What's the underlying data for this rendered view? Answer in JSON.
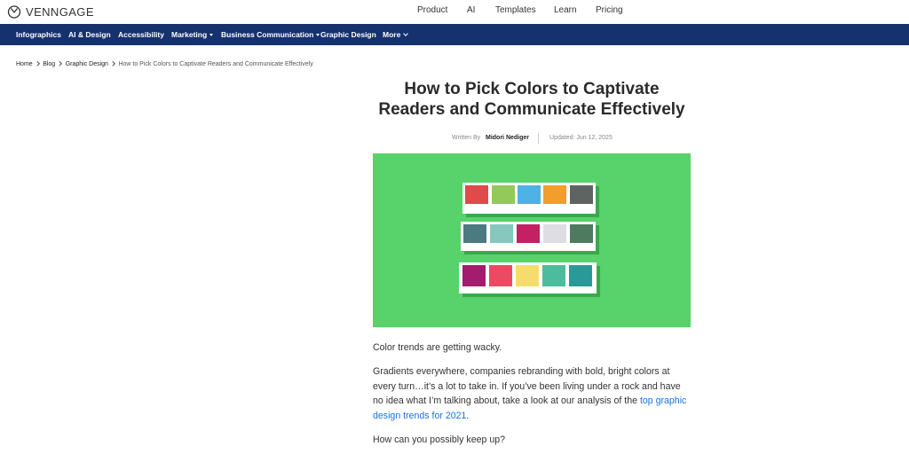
{
  "brand": {
    "name": "VENNGAGE",
    "logo_icon": "venngage-logo-icon"
  },
  "top_nav": {
    "items": [
      "Product",
      "AI",
      "Templates",
      "Learn",
      "Pricing"
    ]
  },
  "sub_nav": {
    "items": [
      {
        "label": "Infographics",
        "dropdown": false
      },
      {
        "label": "AI & Design",
        "dropdown": false
      },
      {
        "label": "Accessibility",
        "dropdown": false
      },
      {
        "label": "Marketing",
        "dropdown": true
      },
      {
        "label": "Business Communication",
        "dropdown": true
      },
      {
        "label": "Graphic Design",
        "dropdown": false
      },
      {
        "label": "More",
        "dropdown": true
      }
    ],
    "background": "#15316e"
  },
  "breadcrumb": [
    "Home",
    "Blog",
    "Graphic Design",
    "How to Pick Colors to Captivate Readers and Communicate Effectively"
  ],
  "article": {
    "title_line1": "How to Pick Colors to Captivate",
    "title_line2": "Readers and Communicate Effectively",
    "written_by_label": "Written By",
    "author": "Midori Nediger",
    "updated": "Updated: Jun 12, 2025",
    "hero": {
      "background": "#58d26a",
      "palettes": [
        [
          "#e14a4a",
          "#93c95a",
          "#4fb2e6",
          "#f39d2a",
          "#5f6462"
        ],
        [
          "#4b7a80",
          "#86c8bd",
          "#c42063",
          "#dedde3",
          "#4e7a60"
        ],
        [
          "#a31c6e",
          "#ec4a62",
          "#f6dc6c",
          "#4cbc9c",
          "#2a9a99"
        ]
      ]
    },
    "paragraph1": "Color trends are getting wacky.",
    "paragraph2_text": "Gradients everywhere, companies rebranding with bold, bright colors at every turn…it’s a lot to take in. If you’ve been living under a rock and have no idea what I’m talking about, take a look at our analysis of the ",
    "paragraph2_link": "top graphic design trends for 2021",
    "paragraph2_end": ".",
    "paragraph3": "How can you possibly keep up?",
    "link_color": "#1a73d8"
  }
}
